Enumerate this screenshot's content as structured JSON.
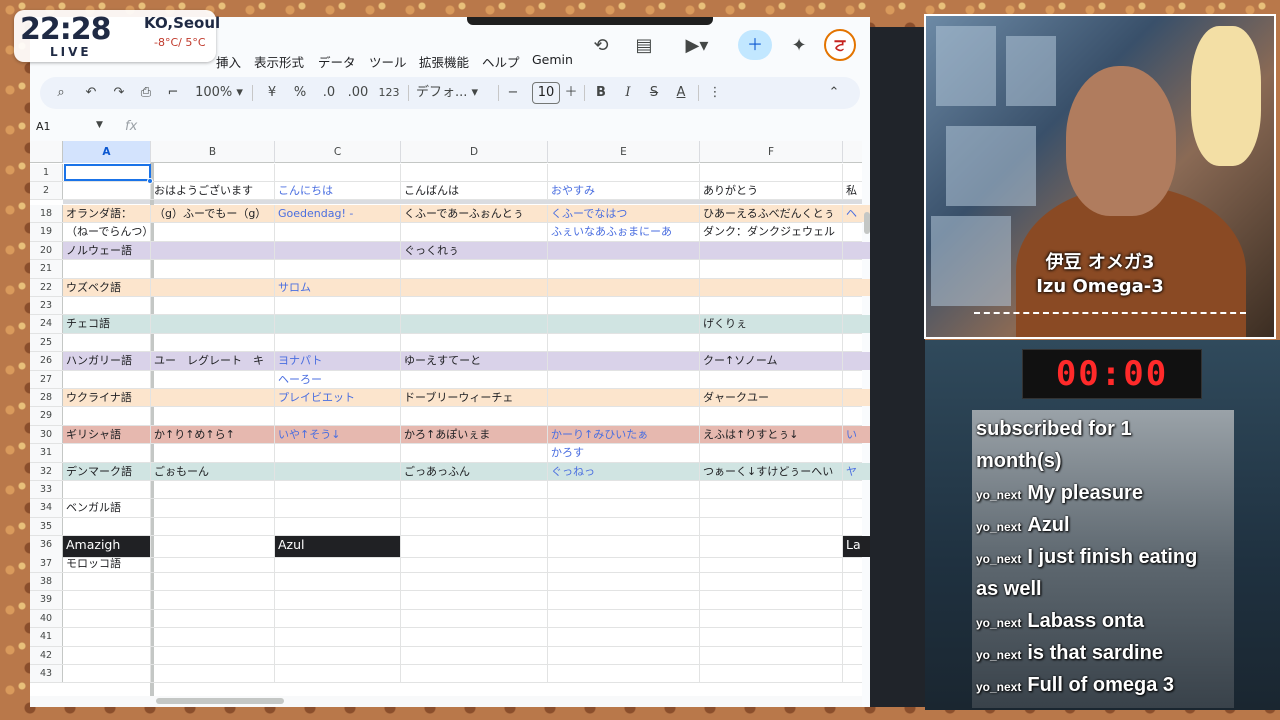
{
  "clock": {
    "time": "22:28",
    "live": "LIVE",
    "city": "KO,Seoul",
    "temp": "-8°C/ 5°C"
  },
  "menu": [
    "挿入",
    "表示形式",
    "データ",
    "ツール",
    "拡張機能",
    "ヘルプ",
    "Gemin"
  ],
  "toolbar": {
    "zoom": "100%",
    "currency": "¥",
    "percent": "%",
    "dec_decrease": ".0",
    "dec_increase": ".00",
    "number_format": "123",
    "font": "デフォ...",
    "font_size": "10"
  },
  "formula": {
    "namebox": "A1",
    "fx": "fx"
  },
  "columns": [
    "A",
    "B",
    "C",
    "D",
    "E",
    "F"
  ],
  "rows": [
    {
      "n": "1",
      "cells": [
        "",
        "",
        "",
        "",
        "",
        ""
      ]
    },
    {
      "n": "2",
      "cells": [
        "",
        "おはようございます",
        "こんにちは",
        "こんばんは",
        "おやすみ",
        "ありがとう",
        "私"
      ]
    },
    {
      "n": "18",
      "cells": [
        "オランダ語：",
        "（g）ふーでもー（g）",
        "Goedendag! -",
        "くふーであーふぉんとぅ",
        "くふーでなはつ",
        "ひあーえるふべだんくとぅ",
        "ヘ"
      ]
    },
    {
      "n": "19",
      "cells": [
        "（ねーでらんつ）",
        "",
        "",
        "",
        "ふぇいなあふぉまにーあ",
        "ダンク：ダンクジェウェル",
        ""
      ]
    },
    {
      "n": "20",
      "cells": [
        "ノルウェー語",
        "",
        "",
        "ぐっくれぅ",
        "",
        "",
        ""
      ]
    },
    {
      "n": "21",
      "cells": [
        "",
        "",
        "",
        "",
        "",
        "",
        ""
      ]
    },
    {
      "n": "22",
      "cells": [
        "ウズベク語",
        "",
        "サロム",
        "",
        "",
        "",
        ""
      ]
    },
    {
      "n": "23",
      "cells": [
        "",
        "",
        "",
        "",
        "",
        "",
        ""
      ]
    },
    {
      "n": "24",
      "cells": [
        "チェコ語",
        "",
        "",
        "",
        "",
        "げくりぇ",
        ""
      ]
    },
    {
      "n": "25",
      "cells": [
        "",
        "",
        "",
        "",
        "",
        "",
        ""
      ]
    },
    {
      "n": "26",
      "cells": [
        "ハンガリー語",
        "ユー　レグレート　キ",
        "ヨナパト",
        "ゆーえすてーと",
        "",
        "クー↑ソノーム",
        ""
      ]
    },
    {
      "n": "27",
      "cells": [
        "",
        "",
        "ヘーろー",
        "",
        "",
        "",
        ""
      ]
    },
    {
      "n": "28",
      "cells": [
        "ウクライナ語",
        "",
        "プレイビエット",
        "ドーブリーウィーチェ",
        "",
        "ダャークユー",
        ""
      ]
    },
    {
      "n": "29",
      "cells": [
        "",
        "",
        "",
        "",
        "",
        "",
        ""
      ]
    },
    {
      "n": "30",
      "cells": [
        "ギリシャ語",
        "か↑り↑め↑ら↑",
        "いや↑そう↓",
        "かろ↑あぽいぇま",
        "かーり↑みひいたぁ",
        "えふは↑りすとぅ↓",
        "い"
      ]
    },
    {
      "n": "31",
      "cells": [
        "",
        "",
        "",
        "",
        "かろす",
        "",
        ""
      ]
    },
    {
      "n": "32",
      "cells": [
        "デンマーク語",
        "ごぉもーん",
        "",
        "ごっあっふん",
        "ぐっねっ",
        "つぁーく↓すけどぅーへい",
        "ヤ"
      ]
    },
    {
      "n": "33",
      "cells": [
        "",
        "",
        "",
        "",
        "",
        "",
        ""
      ]
    },
    {
      "n": "34",
      "cells": [
        "ベンガル語",
        "",
        "",
        "",
        "",
        "",
        ""
      ]
    },
    {
      "n": "35",
      "cells": [
        "",
        "",
        "",
        "",
        "",
        "",
        ""
      ]
    },
    {
      "n": "36",
      "cells": [
        "Amazigh",
        "",
        "Azul",
        "",
        "",
        "",
        "La"
      ]
    },
    {
      "n": "37",
      "cells": [
        "モロッコ語",
        "",
        "",
        "",
        "",
        "",
        ""
      ]
    },
    {
      "n": "38",
      "cells": [
        "",
        "",
        "",
        "",
        "",
        "",
        ""
      ]
    },
    {
      "n": "39",
      "cells": [
        "",
        "",
        "",
        "",
        "",
        "",
        ""
      ]
    },
    {
      "n": "40",
      "cells": [
        "",
        "",
        "",
        "",
        "",
        "",
        ""
      ]
    },
    {
      "n": "41",
      "cells": [
        "",
        "",
        "",
        "",
        "",
        "",
        ""
      ]
    },
    {
      "n": "42",
      "cells": [
        "",
        "",
        "",
        "",
        "",
        "",
        ""
      ]
    },
    {
      "n": "43",
      "cells": [
        "",
        "",
        "",
        "",
        "",
        "",
        ""
      ]
    }
  ],
  "row_colors": {
    "orange": "#fce5cd",
    "purple": "#d9d2e9",
    "teal": "#d0e4e2",
    "red": "#e6b8af",
    "black": "#202124",
    "blue_text": "#4a6ee0"
  },
  "webcam": {
    "caption_jp": "伊豆 オメガ3",
    "caption_en": "Izu Omega-3"
  },
  "timer": "00:00",
  "chat": [
    {
      "user": "",
      "text": "subscribed for 1"
    },
    {
      "user": "",
      "text": "month(s)"
    },
    {
      "user": "yo_next",
      "text": "My pleasure"
    },
    {
      "user": "yo_next",
      "text": "Azul"
    },
    {
      "user": "yo_next",
      "text": "I just finish eating"
    },
    {
      "user": "",
      "text": "as well"
    },
    {
      "user": "yo_next",
      "text": "Labass onta"
    },
    {
      "user": "yo_next",
      "text": "is that sardine"
    },
    {
      "user": "yo_next",
      "text": "Full of omega 3"
    }
  ]
}
